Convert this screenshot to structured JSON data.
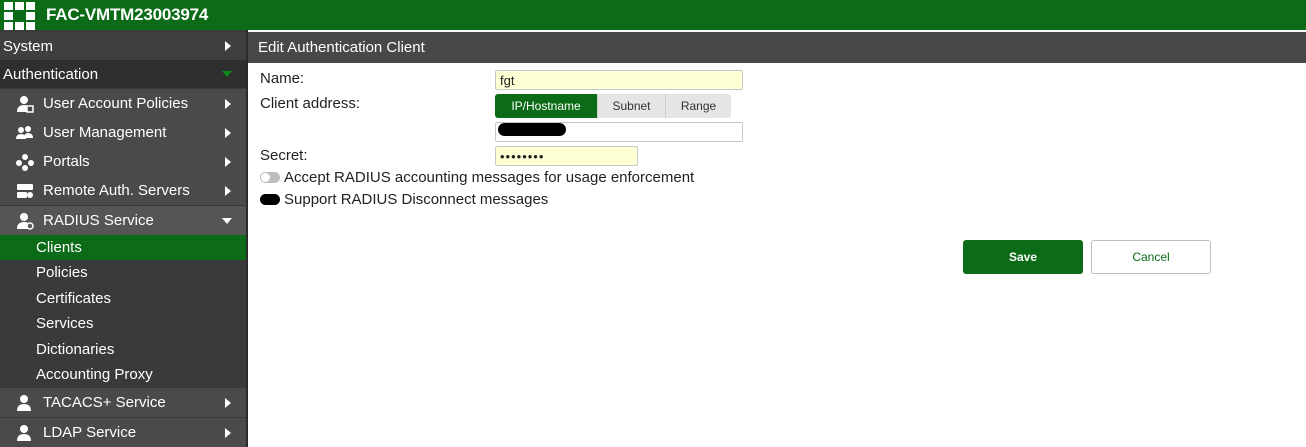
{
  "header": {
    "title": "FAC-VMTM23003974"
  },
  "sidebar": {
    "system": "System",
    "authentication": "Authentication",
    "items": [
      {
        "label": "User Account Policies",
        "icon": "user-policy-icon"
      },
      {
        "label": "User Management",
        "icon": "users-icon"
      },
      {
        "label": "Portals",
        "icon": "portals-icon"
      },
      {
        "label": "Remote Auth. Servers",
        "icon": "server-icon"
      },
      {
        "label": "RADIUS Service",
        "icon": "radius-icon"
      }
    ],
    "radius_sub": [
      "Clients",
      "Policies",
      "Certificates",
      "Services",
      "Dictionaries",
      "Accounting Proxy"
    ],
    "tacacs": "TACACS+ Service",
    "ldap": "LDAP Service"
  },
  "panel": {
    "title": "Edit Authentication Client",
    "name_label": "Name:",
    "name_value": "fgt",
    "client_address_label": "Client address:",
    "address_types": [
      "IP/Hostname",
      "Subnet",
      "Range"
    ],
    "selected_address_type": "IP/Hostname",
    "secret_label": "Secret:",
    "secret_value": "••••••••",
    "accept_accounting_label": "Accept RADIUS accounting messages for usage enforcement",
    "support_disconnect_label": "Support RADIUS Disconnect messages",
    "save_label": "Save",
    "cancel_label": "Cancel"
  },
  "colors": {
    "brand_green": "#0b6b16",
    "sidebar_bg": "#3a3a3a",
    "input_yellow": "#ffffd5"
  }
}
